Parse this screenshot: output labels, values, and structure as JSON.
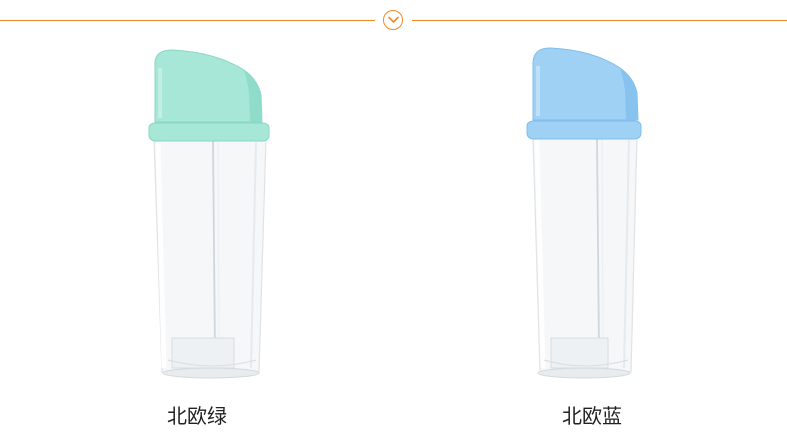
{
  "header": {
    "icon": "chevron-down-icon",
    "accent_color": "#f08a2a"
  },
  "products": [
    {
      "caption": "北欧绿",
      "cap_color": "#a6e7d8",
      "cap_shade": "#90dcca"
    },
    {
      "caption": "北欧蓝",
      "cap_color": "#9fd1f5",
      "cap_shade": "#88c3ef"
    }
  ]
}
